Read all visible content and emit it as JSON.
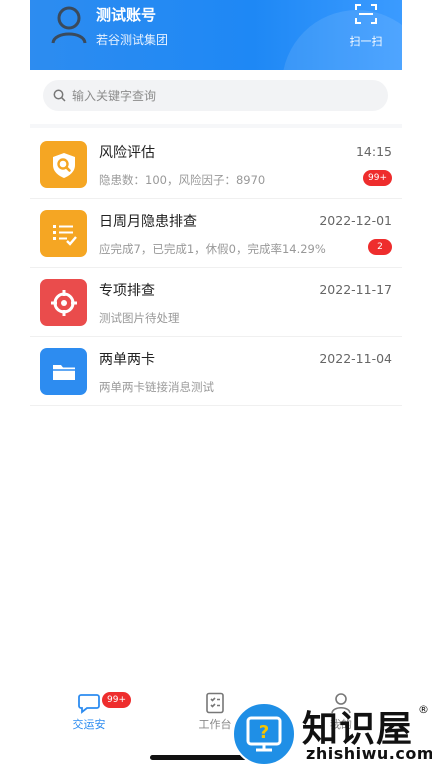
{
  "header": {
    "account_name": "测试账号",
    "org": "若谷测试集团",
    "scan_label": "扫一扫"
  },
  "search": {
    "placeholder": "输入关键字查询"
  },
  "items": [
    {
      "title": "风险评估",
      "time": "14:15",
      "subtitle": "隐患数：100，风险因子：8970",
      "badge": "99+",
      "icon": "shield-search-icon",
      "color": "#f5a623"
    },
    {
      "title": "日周月隐患排查",
      "time": "2022-12-01",
      "subtitle": "应完成7，已完成1，休假0，完成率14.29%",
      "badge": "2",
      "icon": "checklist-icon",
      "color": "#f5a623"
    },
    {
      "title": "专项排查",
      "time": "2022-11-17",
      "subtitle": "测试图片待处理",
      "badge": "",
      "icon": "target-icon",
      "color": "#ea4c4c"
    },
    {
      "title": "两单两卡",
      "time": "2022-11-04",
      "subtitle": "两单两卡链接消息测试",
      "badge": "",
      "icon": "folder-icon",
      "color": "#2d8cf0"
    }
  ],
  "tabs": [
    {
      "label": "交运安",
      "badge": "99+",
      "icon": "chat-icon",
      "active": true
    },
    {
      "label": "工作台",
      "icon": "clipboard-icon"
    },
    {
      "label": "我的",
      "icon": "user-icon"
    }
  ],
  "watermark": {
    "text": "知识屋",
    "url": "zhishiwu.com",
    "reg": "®"
  },
  "colors": {
    "primary": "#2d8cf0",
    "badge": "#ee2d2d"
  }
}
